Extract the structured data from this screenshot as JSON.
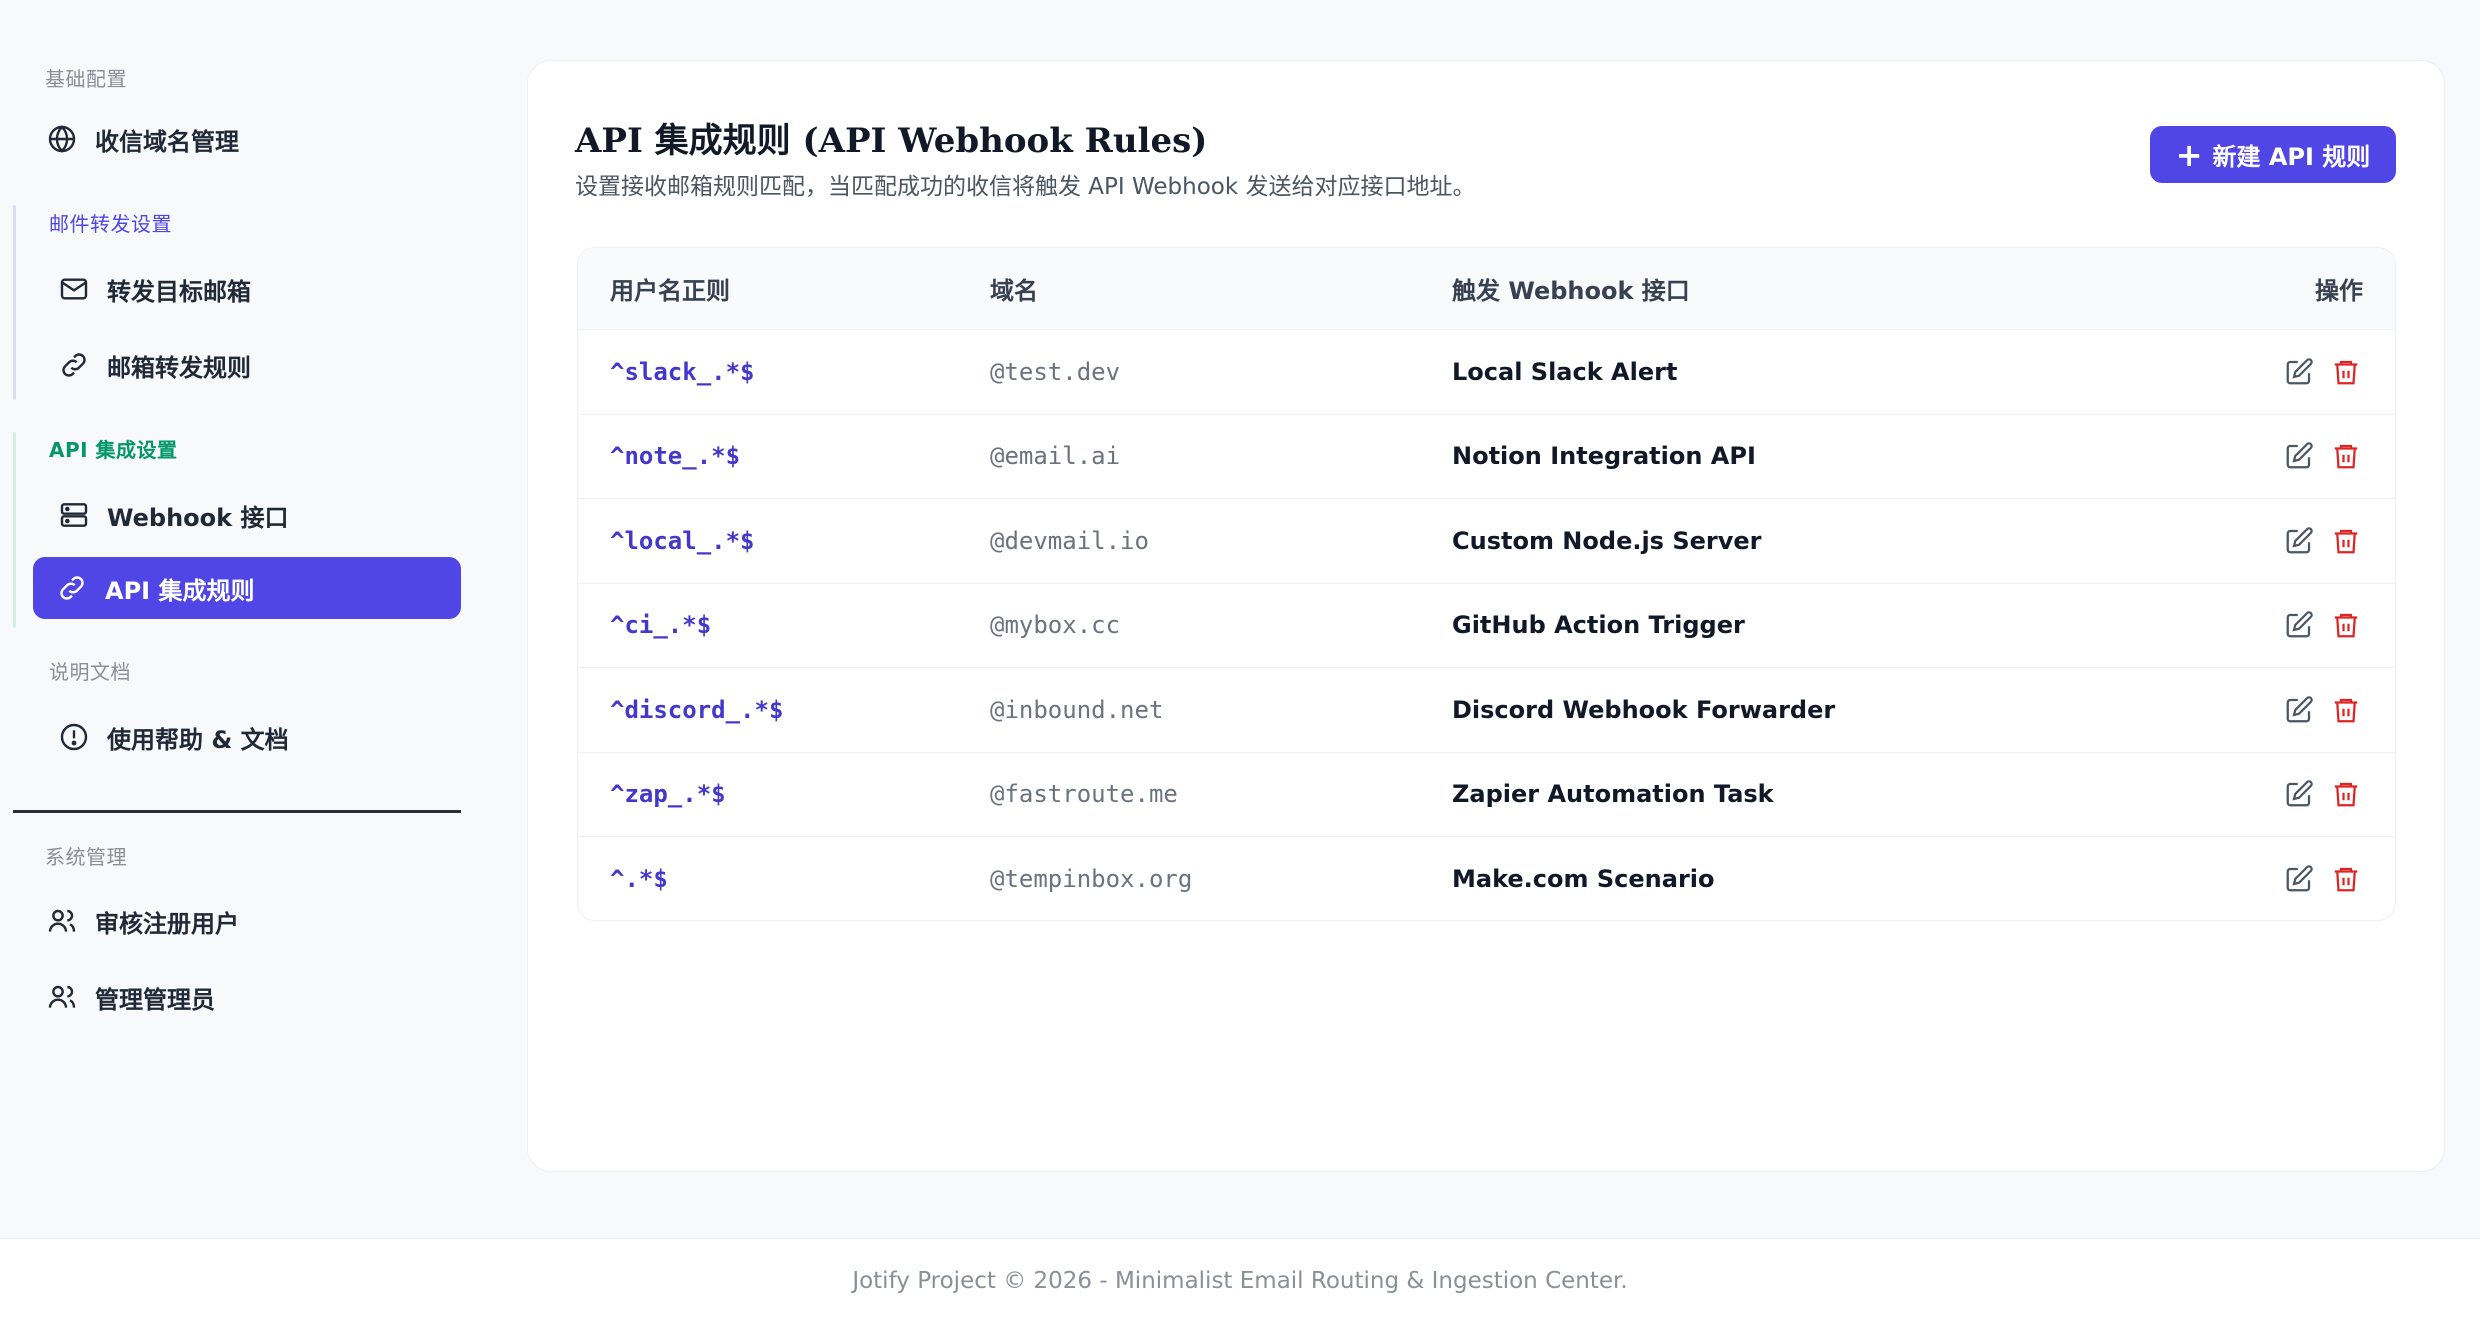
{
  "sidebar": {
    "sections": {
      "basic": "基础配置",
      "forward": "邮件转发设置",
      "api": "API 集成设置",
      "docs": "说明文档",
      "system": "系统管理"
    },
    "items": {
      "domains": "收信域名管理",
      "targets": "转发目标邮箱",
      "forward_rules": "邮箱转发规则",
      "webhooks": "Webhook 接口",
      "api_rules": "API 集成规则",
      "help": "使用帮助 & 文档",
      "review_users": "审核注册用户",
      "admins": "管理管理员"
    }
  },
  "main": {
    "title": "API 集成规则 (API Webhook Rules)",
    "subtitle": "设置接收邮箱规则匹配，当匹配成功的收信将触发 API Webhook 发送给对应接口地址。",
    "new_button": "新建 API 规则",
    "table": {
      "headers": [
        "用户名正则",
        "域名",
        "触发 Webhook 接口",
        "操作"
      ],
      "rows": [
        {
          "regex": "^slack_.*$",
          "domain": "@test.dev",
          "webhook": "Local Slack Alert"
        },
        {
          "regex": "^note_.*$",
          "domain": "@email.ai",
          "webhook": "Notion Integration API"
        },
        {
          "regex": "^local_.*$",
          "domain": "@devmail.io",
          "webhook": "Custom Node.js Server"
        },
        {
          "regex": "^ci_.*$",
          "domain": "@mybox.cc",
          "webhook": "GitHub Action Trigger"
        },
        {
          "regex": "^discord_.*$",
          "domain": "@inbound.net",
          "webhook": "Discord Webhook Forwarder"
        },
        {
          "regex": "^zap_.*$",
          "domain": "@fastroute.me",
          "webhook": "Zapier Automation Task"
        },
        {
          "regex": "^.*$",
          "domain": "@tempinbox.org",
          "webhook": "Make.com Scenario"
        }
      ]
    }
  },
  "footer": {
    "text": "Jotify Project © 2026 - Minimalist Email Routing & Ingestion Center."
  },
  "colors": {
    "accent": "#4f46e5",
    "api_section": "#059669",
    "delete": "#dc2626"
  }
}
